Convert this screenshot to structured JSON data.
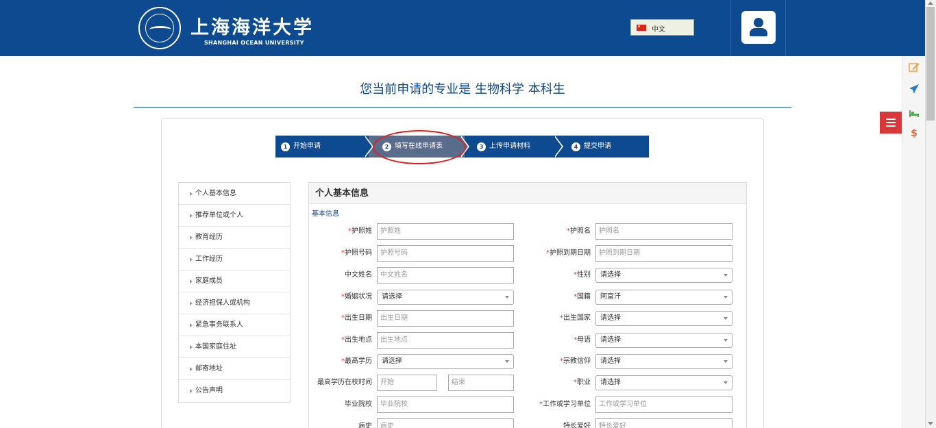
{
  "header": {
    "title_cn": "上海海洋大学",
    "title_en": "SHANGHAI OCEAN UNIVERSITY",
    "language": "中文"
  },
  "page_title": "您当前申请的专业是 生物科学 本科生",
  "steps": [
    {
      "num": "1",
      "label": "开始申请"
    },
    {
      "num": "2",
      "label": "填写在线申请表"
    },
    {
      "num": "3",
      "label": "上传申请材料"
    },
    {
      "num": "4",
      "label": "提交申请"
    }
  ],
  "nav": [
    "个人基本信息",
    "推荐单位或个人",
    "教育经历",
    "工作经历",
    "家庭成员",
    "经济担保人或机构",
    "紧急事务联系人",
    "本国家庭住址",
    "邮寄地址",
    "公告声明"
  ],
  "form": {
    "heading": "个人基本信息",
    "section": "基本信息",
    "left": [
      {
        "label": "护照姓",
        "required": "*",
        "type": "input",
        "placeholder": "护照姓"
      },
      {
        "label": "护照号码",
        "required": "*",
        "type": "input",
        "placeholder": "护照号码"
      },
      {
        "label": "中文姓名",
        "required": "",
        "type": "input",
        "placeholder": "中文姓名"
      },
      {
        "label": "婚姻状况",
        "required": "*",
        "type": "select",
        "value": "请选择"
      },
      {
        "label": "出生日期",
        "required": "*",
        "type": "input",
        "placeholder": "出生日期"
      },
      {
        "label": "出生地点",
        "required": "*",
        "type": "input",
        "placeholder": "出生地点"
      },
      {
        "label": "最高学历",
        "required": "*",
        "type": "select",
        "value": "请选择"
      },
      {
        "label": "最高学历在校时间",
        "required": "",
        "type": "range",
        "placeholder_start": "开始",
        "placeholder_end": "结束"
      },
      {
        "label": "毕业院校",
        "required": "",
        "type": "input",
        "placeholder": "毕业院校"
      },
      {
        "label": "病史",
        "required": "",
        "type": "input",
        "placeholder": "病史"
      }
    ],
    "right": [
      {
        "label": "护照名",
        "required": "*",
        "type": "input",
        "placeholder": "护照名"
      },
      {
        "label": "护照到期日期",
        "required": "*",
        "type": "input",
        "placeholder": "护照到期日期"
      },
      {
        "label": "性别",
        "required": "*",
        "type": "select",
        "value": "请选择"
      },
      {
        "label": "国籍",
        "required": "*",
        "type": "select",
        "value": "阿富汗"
      },
      {
        "label": "出生国家",
        "required": "*",
        "type": "select",
        "value": "请选择"
      },
      {
        "label": "母语",
        "required": "*",
        "type": "select",
        "value": "请选择"
      },
      {
        "label": "宗教信仰",
        "required": "*",
        "type": "select",
        "value": "请选择"
      },
      {
        "label": "职业",
        "required": "*",
        "type": "select",
        "value": "请选择"
      },
      {
        "label": "工作或学习单位",
        "required": "*",
        "type": "input",
        "placeholder": "工作或学习单位"
      },
      {
        "label": "特长爱好",
        "required": "",
        "type": "input",
        "placeholder": "特长爱好"
      }
    ]
  },
  "colors": {
    "brand": "#0e4a8f",
    "accent_red": "#d9383a",
    "step_active": "#5a6c8c"
  },
  "side_icons": [
    "edit-icon",
    "plane-icon",
    "bed-icon",
    "dollar-icon"
  ]
}
